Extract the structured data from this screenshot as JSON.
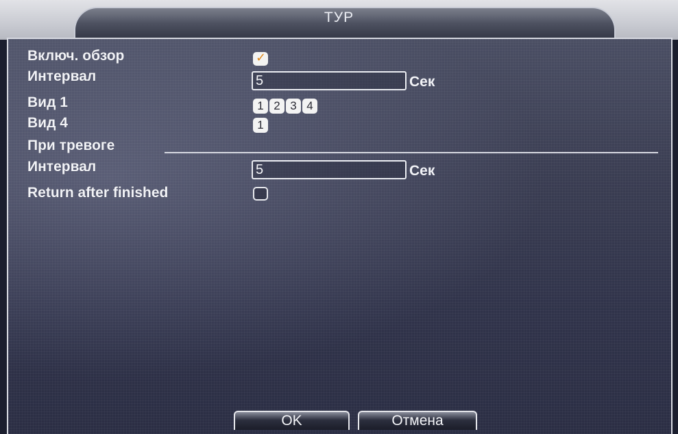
{
  "window": {
    "title": "ТУР"
  },
  "tour": {
    "enable_label": "Включ. обзор",
    "enable_checked": true,
    "interval_label": "Интервал",
    "interval_value": "5",
    "interval_unit": "Сек",
    "view1_label": "Вид 1",
    "view1_channels": [
      "1",
      "2",
      "3",
      "4"
    ],
    "view4_label": "Вид 4",
    "view4_channels": [
      "1"
    ]
  },
  "alarm": {
    "section_label": "При тревоге",
    "interval_label": "Интервал",
    "interval_value": "5",
    "interval_unit": "Сек",
    "return_label": "Return after finished",
    "return_checked": false
  },
  "buttons": {
    "ok": "OK",
    "cancel": "Отмена"
  },
  "colors": {
    "checkmark": "#e08a1e",
    "panel": "#3a3d52"
  }
}
